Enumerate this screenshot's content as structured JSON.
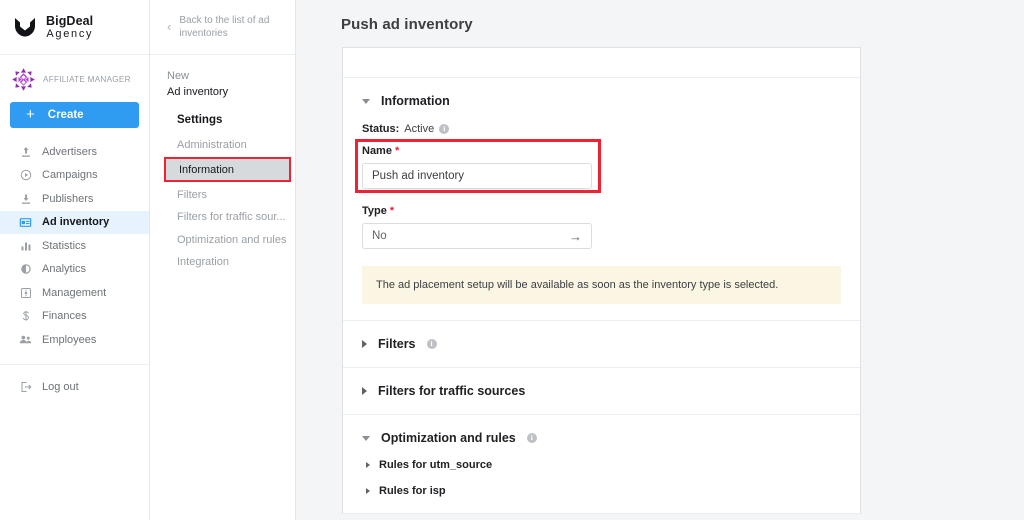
{
  "brand": {
    "name": "BigDeal",
    "subtitle": "Agency",
    "logo_icon": "shield-logo-icon"
  },
  "account": {
    "label": "AFFILIATE MANAGER",
    "avatar_icon": "account-avatar-icon"
  },
  "create_button": {
    "label": "Create",
    "icon": "plus-icon",
    "color": "#2f9bf1"
  },
  "sidebar": {
    "items": [
      {
        "label": "Advertisers",
        "icon": "upload-arrow-icon",
        "active": false
      },
      {
        "label": "Campaigns",
        "icon": "play-circle-icon",
        "active": false
      },
      {
        "label": "Publishers",
        "icon": "download-arrow-icon",
        "active": false
      },
      {
        "label": "Ad inventory",
        "icon": "ad-banner-icon",
        "active": true
      },
      {
        "label": "Statistics",
        "icon": "bar-chart-icon",
        "active": false
      },
      {
        "label": "Analytics",
        "icon": "pie-chart-icon",
        "active": false
      },
      {
        "label": "Management",
        "icon": "settings-square-icon",
        "active": false
      },
      {
        "label": "Finances",
        "icon": "dollar-icon",
        "active": false
      },
      {
        "label": "Employees",
        "icon": "people-icon",
        "active": false
      }
    ],
    "logout": {
      "label": "Log out",
      "icon": "logout-icon"
    },
    "active_bg": "#e6f2fd"
  },
  "subnav": {
    "back_label": "Back to the list of ad inventories",
    "back_icon": "chevron-left-icon",
    "title_line1": "New",
    "title_line2": "Ad inventory",
    "section_heading": "Settings",
    "items": [
      {
        "label": "Administration",
        "selected": false
      },
      {
        "label": "Information",
        "selected": true
      },
      {
        "label": "Filters",
        "selected": false
      },
      {
        "label": "Filters for traffic sour...",
        "selected": false
      },
      {
        "label": "Optimization and rules",
        "selected": false
      },
      {
        "label": "Integration",
        "selected": false
      }
    ],
    "highlight_color": "#ee2233"
  },
  "main": {
    "page_title": "Push ad inventory",
    "information": {
      "title": "Information",
      "caret": "caret-down-icon",
      "status_label": "Status:",
      "status_value": "Active",
      "status_info_icon": "info-icon",
      "name_field": {
        "label": "Name",
        "required_mark": "*",
        "value": "Push ad inventory",
        "placeholder": "Push ad inventory",
        "highlighted": true
      },
      "type_field": {
        "label": "Type",
        "required_mark": "*",
        "value": "No",
        "arrow_icon": "arrow-right-icon"
      },
      "notice": "The ad placement setup will be available as soon as the inventory type is selected.",
      "notice_bg": "#fbf5e3"
    },
    "filters_section": {
      "title": "Filters",
      "caret": "caret-right-icon",
      "info_icon": "info-icon"
    },
    "traffic_sources_section": {
      "title": "Filters for traffic sources",
      "caret": "caret-right-icon"
    },
    "optimization_section": {
      "title": "Optimization and rules",
      "caret": "caret-down-icon",
      "info_icon": "info-icon",
      "rules": [
        {
          "label": "Rules for utm_source",
          "caret": "caret-right-icon"
        },
        {
          "label": "Rules for isp",
          "caret": "caret-right-icon"
        }
      ]
    }
  }
}
